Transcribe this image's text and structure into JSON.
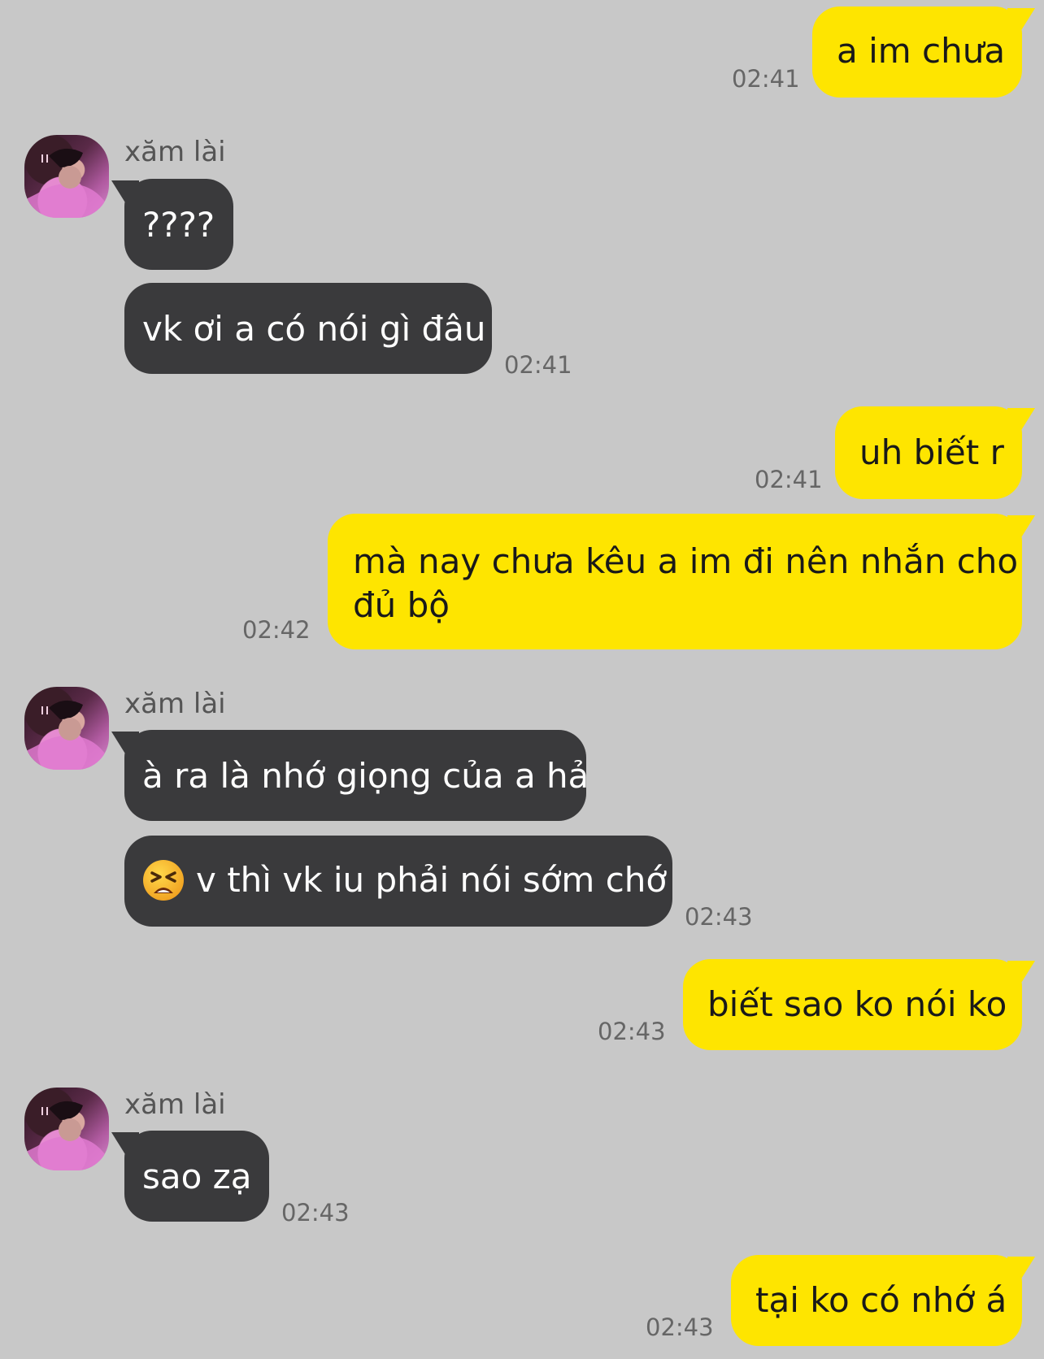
{
  "contact": {
    "name": "xăm lài"
  },
  "messages": [
    {
      "direction": "out",
      "text": "a im chưa",
      "time": "02:41"
    },
    {
      "direction": "in",
      "text": "????",
      "time": ""
    },
    {
      "direction": "in",
      "text": "vk ơi a có nói gì đâu",
      "time": "02:41"
    },
    {
      "direction": "out",
      "text": "uh biết r",
      "time": "02:41"
    },
    {
      "direction": "out",
      "text_line1": "mà nay chưa kêu a im đi nên nhắn cho",
      "text_line2": "đủ bộ",
      "time": "02:42"
    },
    {
      "direction": "in",
      "text": "à ra là nhớ giọng của a hả",
      "time": ""
    },
    {
      "direction": "in",
      "emoji": "tired-face-emoji",
      "text": "v thì vk iu phải nói sớm chớ",
      "time": "02:43"
    },
    {
      "direction": "out",
      "text": "biết sao ko nói ko",
      "time": "02:43"
    },
    {
      "direction": "in",
      "text": "sao zạ",
      "time": "02:43"
    },
    {
      "direction": "out",
      "text": "tại ko có nhớ á",
      "time": "02:43"
    }
  ],
  "colors": {
    "background": "#c8c8c8",
    "outgoing_bubble": "#fee500",
    "incoming_bubble": "#3a3a3c",
    "outgoing_text": "#191919",
    "incoming_text": "#ffffff",
    "timestamp": "#666666"
  }
}
